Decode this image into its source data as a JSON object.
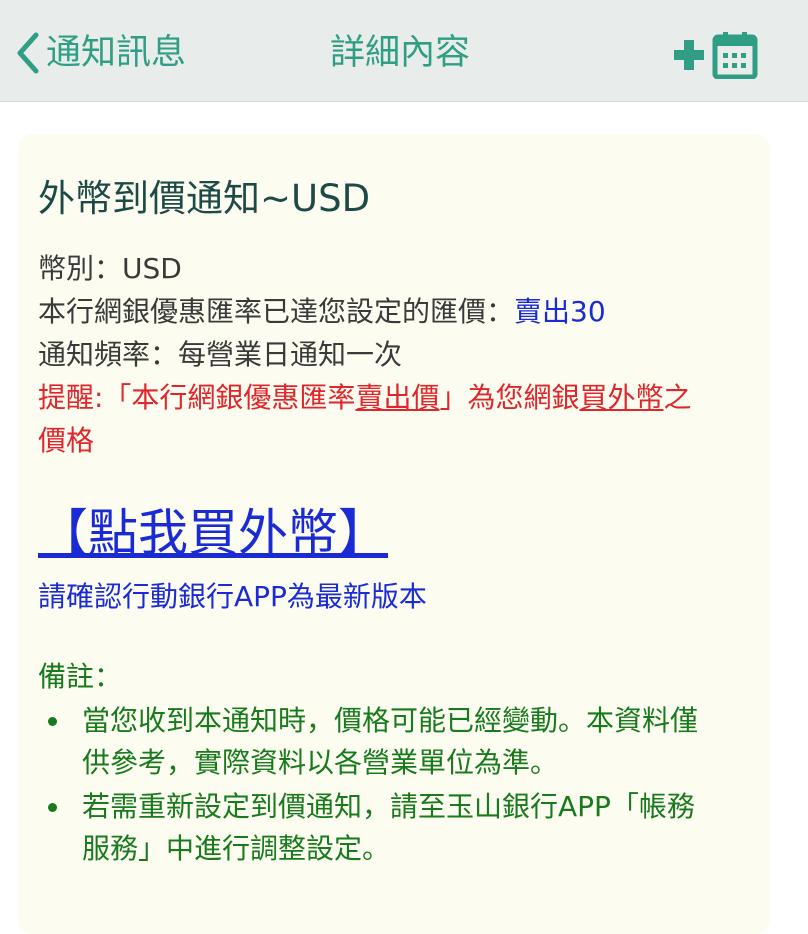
{
  "navbar": {
    "back_label": "通知訊息",
    "title": "詳細內容",
    "add_calendar_icon": "add-to-calendar-icon",
    "accent_color": "#2f9e85"
  },
  "notice": {
    "title": "外幣到價通知~USD",
    "currency_line": "幣別：USD",
    "rate_reached_prefix": "本行網銀優惠匯率已達您設定的匯價：",
    "rate_reached_value": "賣出30",
    "frequency_line": "通知頻率：每營業日通知一次",
    "reminder": {
      "part1": "提醒:「本行網銀優惠匯率",
      "part2_underlined": "賣出價",
      "part3": "」為您網銀",
      "part4_underlined": "買外幣",
      "part5": "之",
      "part6": "價格"
    },
    "buy_link": "【點我買外幣】",
    "app_update_note": "請確認行動銀行APP為最新版本",
    "remarks_label": "備註：",
    "remarks": [
      {
        "line1": "當您收到本通知時，價格可能已經變動。本資料僅",
        "line2": "供參考，實際資料以各營業單位為準。"
      },
      {
        "line1": "若需重新設定到價通知，請至玉山銀行APP「帳務",
        "line2": "服務」中進行調整設定。"
      }
    ]
  }
}
